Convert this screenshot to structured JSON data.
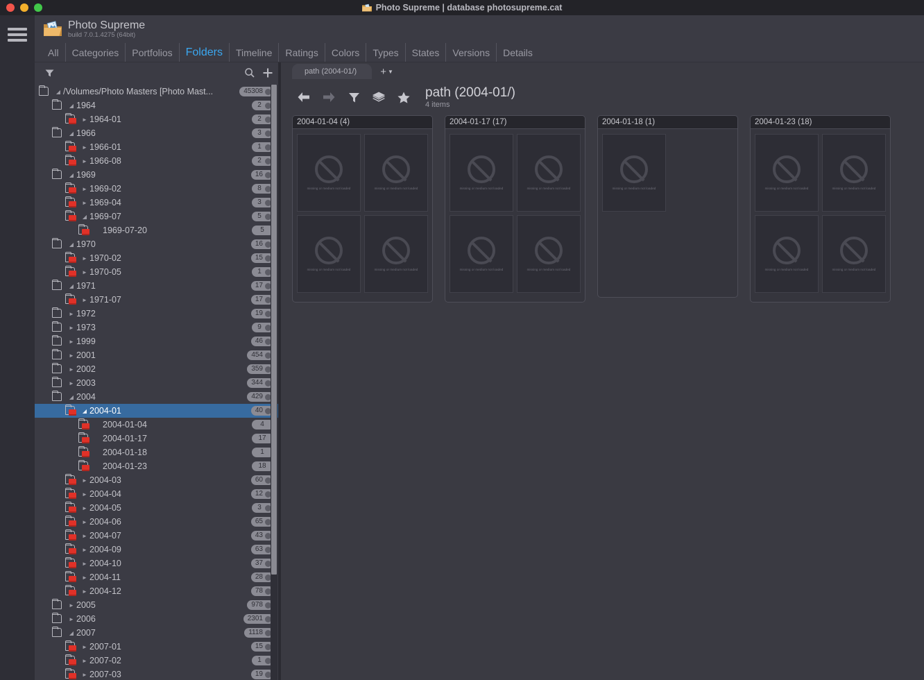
{
  "window": {
    "title": "Photo Supreme | database photosupreme.cat",
    "traffic": {
      "close": "close-button",
      "minimize": "minimize-button",
      "zoom": "zoom-button"
    }
  },
  "app": {
    "name": "Photo Supreme",
    "build": "build 7.0.1.4275 (64bit)",
    "menu_icon": "hamburger-menu-icon"
  },
  "tabs": [
    {
      "label": "All",
      "active": false
    },
    {
      "label": "Categories",
      "active": false
    },
    {
      "label": "Portfolios",
      "active": false
    },
    {
      "label": "Folders",
      "active": true
    },
    {
      "label": "Timeline",
      "active": false
    },
    {
      "label": "Ratings",
      "active": false
    },
    {
      "label": "Colors",
      "active": false
    },
    {
      "label": "Types",
      "active": false
    },
    {
      "label": "States",
      "active": false
    },
    {
      "label": "Versions",
      "active": false
    },
    {
      "label": "Details",
      "active": false
    }
  ],
  "sidebar": {
    "tools": [
      {
        "name": "filter-icon",
        "label": "Filter"
      },
      {
        "name": "search-icon",
        "label": "Search"
      },
      {
        "name": "add-icon",
        "label": "Add"
      }
    ],
    "accent_selected": "#376ba0",
    "tree": [
      {
        "label": "/Volumes/Photo Masters  [Photo Mast...",
        "indent": 0,
        "state": "expanded",
        "icon": "folder-plain",
        "count": "45308",
        "dot": true,
        "selected": false
      },
      {
        "label": "1964",
        "indent": 1,
        "state": "expanded",
        "icon": "folder-plain",
        "count": "2",
        "dot": true,
        "selected": false
      },
      {
        "label": "1964-01",
        "indent": 2,
        "state": "collapsed",
        "icon": "folder-stack",
        "count": "2",
        "dot": true,
        "selected": false
      },
      {
        "label": "1966",
        "indent": 1,
        "state": "expanded",
        "icon": "folder-plain",
        "count": "3",
        "dot": true,
        "selected": false
      },
      {
        "label": "1966-01",
        "indent": 2,
        "state": "collapsed",
        "icon": "folder-stack",
        "count": "1",
        "dot": true,
        "selected": false
      },
      {
        "label": "1966-08",
        "indent": 2,
        "state": "collapsed",
        "icon": "folder-stack",
        "count": "2",
        "dot": true,
        "selected": false
      },
      {
        "label": "1969",
        "indent": 1,
        "state": "expanded",
        "icon": "folder-plain",
        "count": "16",
        "dot": true,
        "selected": false
      },
      {
        "label": "1969-02",
        "indent": 2,
        "state": "collapsed",
        "icon": "folder-stack",
        "count": "8",
        "dot": true,
        "selected": false
      },
      {
        "label": "1969-04",
        "indent": 2,
        "state": "collapsed",
        "icon": "folder-stack",
        "count": "3",
        "dot": true,
        "selected": false
      },
      {
        "label": "1969-07",
        "indent": 2,
        "state": "expanded",
        "icon": "folder-stack",
        "count": "5",
        "dot": true,
        "selected": false
      },
      {
        "label": "1969-07-20",
        "indent": 3,
        "state": "leaf",
        "icon": "folder-stack",
        "count": "5",
        "dot": false,
        "selected": false
      },
      {
        "label": "1970",
        "indent": 1,
        "state": "expanded",
        "icon": "folder-plain",
        "count": "16",
        "dot": true,
        "selected": false
      },
      {
        "label": "1970-02",
        "indent": 2,
        "state": "collapsed",
        "icon": "folder-stack",
        "count": "15",
        "dot": true,
        "selected": false
      },
      {
        "label": "1970-05",
        "indent": 2,
        "state": "collapsed",
        "icon": "folder-stack",
        "count": "1",
        "dot": true,
        "selected": false
      },
      {
        "label": "1971",
        "indent": 1,
        "state": "expanded",
        "icon": "folder-plain",
        "count": "17",
        "dot": true,
        "selected": false
      },
      {
        "label": "1971-07",
        "indent": 2,
        "state": "collapsed",
        "icon": "folder-stack",
        "count": "17",
        "dot": true,
        "selected": false
      },
      {
        "label": "1972",
        "indent": 1,
        "state": "collapsed",
        "icon": "folder-plain",
        "count": "19",
        "dot": true,
        "selected": false
      },
      {
        "label": "1973",
        "indent": 1,
        "state": "collapsed",
        "icon": "folder-plain",
        "count": "9",
        "dot": true,
        "selected": false
      },
      {
        "label": "1999",
        "indent": 1,
        "state": "collapsed",
        "icon": "folder-plain",
        "count": "46",
        "dot": true,
        "selected": false
      },
      {
        "label": "2001",
        "indent": 1,
        "state": "collapsed",
        "icon": "folder-plain",
        "count": "454",
        "dot": true,
        "selected": false
      },
      {
        "label": "2002",
        "indent": 1,
        "state": "collapsed",
        "icon": "folder-plain",
        "count": "359",
        "dot": true,
        "selected": false
      },
      {
        "label": "2003",
        "indent": 1,
        "state": "collapsed",
        "icon": "folder-plain",
        "count": "344",
        "dot": true,
        "selected": false
      },
      {
        "label": "2004",
        "indent": 1,
        "state": "expanded",
        "icon": "folder-plain",
        "count": "429",
        "dot": true,
        "selected": false
      },
      {
        "label": "2004-01",
        "indent": 2,
        "state": "expanded",
        "icon": "folder-stack",
        "count": "40",
        "dot": true,
        "selected": true
      },
      {
        "label": "2004-01-04",
        "indent": 3,
        "state": "leaf",
        "icon": "folder-stack",
        "count": "4",
        "dot": false,
        "selected": false
      },
      {
        "label": "2004-01-17",
        "indent": 3,
        "state": "leaf",
        "icon": "folder-stack",
        "count": "17",
        "dot": false,
        "selected": false
      },
      {
        "label": "2004-01-18",
        "indent": 3,
        "state": "leaf",
        "icon": "folder-stack",
        "count": "1",
        "dot": false,
        "selected": false
      },
      {
        "label": "2004-01-23",
        "indent": 3,
        "state": "leaf",
        "icon": "folder-stack",
        "count": "18",
        "dot": false,
        "selected": false
      },
      {
        "label": "2004-03",
        "indent": 2,
        "state": "collapsed",
        "icon": "folder-stack",
        "count": "60",
        "dot": true,
        "selected": false
      },
      {
        "label": "2004-04",
        "indent": 2,
        "state": "collapsed",
        "icon": "folder-stack",
        "count": "12",
        "dot": true,
        "selected": false
      },
      {
        "label": "2004-05",
        "indent": 2,
        "state": "collapsed",
        "icon": "folder-stack",
        "count": "3",
        "dot": true,
        "selected": false
      },
      {
        "label": "2004-06",
        "indent": 2,
        "state": "collapsed",
        "icon": "folder-stack",
        "count": "65",
        "dot": true,
        "selected": false
      },
      {
        "label": "2004-07",
        "indent": 2,
        "state": "collapsed",
        "icon": "folder-stack",
        "count": "43",
        "dot": true,
        "selected": false
      },
      {
        "label": "2004-09",
        "indent": 2,
        "state": "collapsed",
        "icon": "folder-stack",
        "count": "63",
        "dot": true,
        "selected": false
      },
      {
        "label": "2004-10",
        "indent": 2,
        "state": "collapsed",
        "icon": "folder-stack",
        "count": "37",
        "dot": true,
        "selected": false
      },
      {
        "label": "2004-11",
        "indent": 2,
        "state": "collapsed",
        "icon": "folder-stack",
        "count": "28",
        "dot": true,
        "selected": false
      },
      {
        "label": "2004-12",
        "indent": 2,
        "state": "collapsed",
        "icon": "folder-stack",
        "count": "78",
        "dot": true,
        "selected": false
      },
      {
        "label": "2005",
        "indent": 1,
        "state": "collapsed",
        "icon": "folder-plain",
        "count": "978",
        "dot": true,
        "selected": false
      },
      {
        "label": "2006",
        "indent": 1,
        "state": "collapsed",
        "icon": "folder-plain",
        "count": "2301",
        "dot": true,
        "selected": false
      },
      {
        "label": "2007",
        "indent": 1,
        "state": "expanded",
        "icon": "folder-plain",
        "count": "1118",
        "dot": true,
        "selected": false
      },
      {
        "label": "2007-01",
        "indent": 2,
        "state": "collapsed",
        "icon": "folder-stack",
        "count": "15",
        "dot": true,
        "selected": false
      },
      {
        "label": "2007-02",
        "indent": 2,
        "state": "collapsed",
        "icon": "folder-stack",
        "count": "1",
        "dot": true,
        "selected": false
      },
      {
        "label": "2007-03",
        "indent": 2,
        "state": "collapsed",
        "icon": "folder-stack",
        "count": "19",
        "dot": true,
        "selected": false
      }
    ]
  },
  "main": {
    "doc_tab": "path (2004-01/)",
    "add_tab_label": "+",
    "toolbar": [
      {
        "name": "back-icon",
        "label": "Back",
        "enabled": true
      },
      {
        "name": "forward-icon",
        "label": "Forward",
        "enabled": false
      },
      {
        "name": "filter-icon",
        "label": "Filter",
        "enabled": true
      },
      {
        "name": "layers-icon",
        "label": "Layers",
        "enabled": true
      },
      {
        "name": "star-icon",
        "label": "Favorite",
        "enabled": true
      }
    ],
    "title": "path (2004-01/)",
    "subtitle": "4 items",
    "thumb_caption": "missing or medium not loaded",
    "groups": [
      {
        "header": "2004-01-04 (4)",
        "thumbs": 4
      },
      {
        "header": "2004-01-17 (17)",
        "thumbs": 4
      },
      {
        "header": "2004-01-18 (1)",
        "thumbs": 1
      },
      {
        "header": "2004-01-23 (18)",
        "thumbs": 4
      }
    ]
  }
}
